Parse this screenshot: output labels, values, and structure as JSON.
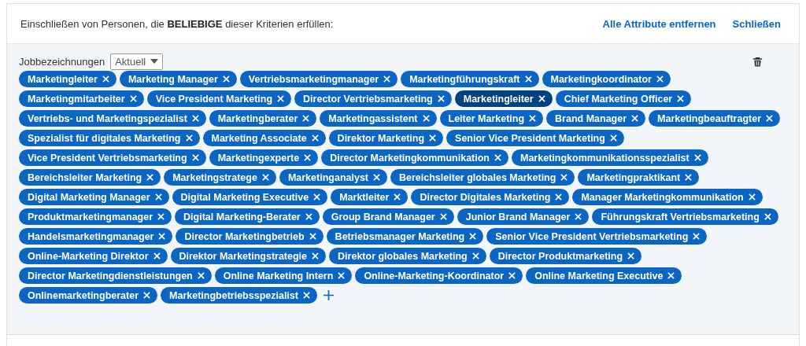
{
  "header": {
    "text": "Einschließen von Personen, die **BELIEBIGE** dieser Kriterien erfüllen:",
    "links": [
      "Alle Attribute entfernen",
      "Schließen"
    ]
  },
  "filter": {
    "label": "Jobbezeichnungen",
    "dropdown": "Aktuell",
    "tags": [
      {
        "label": "Marketingleiter",
        "selected": false
      },
      {
        "label": "Marketing Manager",
        "selected": false
      },
      {
        "label": "Vertriebsmarketingmanager",
        "selected": false
      },
      {
        "label": "Marketingführungskraft",
        "selected": false
      },
      {
        "label": "Marketingkoordinator",
        "selected": false
      },
      {
        "label": "Marketingmitarbeiter",
        "selected": false
      },
      {
        "label": "Vice President Marketing",
        "selected": false
      },
      {
        "label": "Director Vertriebsmarketing",
        "selected": false
      },
      {
        "label": "Marketingleiter",
        "selected": true
      },
      {
        "label": "Chief Marketing Officer",
        "selected": false
      },
      {
        "label": "Vertriebs- und Marketingspezialist",
        "selected": false
      },
      {
        "label": "Marketingberater",
        "selected": false
      },
      {
        "label": "Marketingassistent",
        "selected": false
      },
      {
        "label": "Leiter Marketing",
        "selected": false
      },
      {
        "label": "Brand Manager",
        "selected": false
      },
      {
        "label": "Marketingbeauftragter",
        "selected": false
      },
      {
        "label": "Spezialist für digitales Marketing",
        "selected": false
      },
      {
        "label": "Marketing Associate",
        "selected": false
      },
      {
        "label": "Direktor Marketing",
        "selected": false
      },
      {
        "label": "Senior Vice President Marketing",
        "selected": false
      },
      {
        "label": "Vice President Vertriebsmarketing",
        "selected": false
      },
      {
        "label": "Marketingexperte",
        "selected": false
      },
      {
        "label": "Director Marketingkommunikation",
        "selected": false
      },
      {
        "label": "Marketingkommunikationsspezialist",
        "selected": false
      },
      {
        "label": "Bereichsleiter Marketing",
        "selected": false
      },
      {
        "label": "Marketingstratege",
        "selected": false
      },
      {
        "label": "Marketinganalyst",
        "selected": false
      },
      {
        "label": "Bereichsleiter globales Marketing",
        "selected": false
      },
      {
        "label": "Marketingpraktikant",
        "selected": false
      },
      {
        "label": "Digital Marketing Manager",
        "selected": false
      },
      {
        "label": "Digital Marketing Executive",
        "selected": false
      },
      {
        "label": "Marktleiter",
        "selected": false
      },
      {
        "label": "Director Digitales Marketing",
        "selected": false
      },
      {
        "label": "Manager Marketingkommunikation",
        "selected": false
      },
      {
        "label": "Produktmarketingmanager",
        "selected": false
      },
      {
        "label": "Digital Marketing-Berater",
        "selected": false
      },
      {
        "label": "Group Brand Manager",
        "selected": false
      },
      {
        "label": "Junior Brand Manager",
        "selected": false
      },
      {
        "label": "Führungskraft Vertriebsmarketing",
        "selected": false
      },
      {
        "label": "Handelsmarketingmanager",
        "selected": false
      },
      {
        "label": "Director Marketingbetrieb",
        "selected": false
      },
      {
        "label": "Betriebsmanager Marketing",
        "selected": false
      },
      {
        "label": "Senior Vice President Vertriebsmarketing",
        "selected": false
      },
      {
        "label": "Online-Marketing Direktor",
        "selected": false
      },
      {
        "label": "Direktor Marketingstrategie",
        "selected": false
      },
      {
        "label": "Direktor globales Marketing",
        "selected": false
      },
      {
        "label": "Director Produktmarketing",
        "selected": false
      },
      {
        "label": "Director Marketingdienstleistungen",
        "selected": false
      },
      {
        "label": "Online Marketing Intern",
        "selected": false
      },
      {
        "label": "Online-Marketing-Koordinator",
        "selected": false
      },
      {
        "label": "Online Marketing Executive",
        "selected": false
      },
      {
        "label": "Onlinemarketingberater",
        "selected": false
      },
      {
        "label": "Marketingbetriebsspezialist",
        "selected": false
      }
    ]
  }
}
